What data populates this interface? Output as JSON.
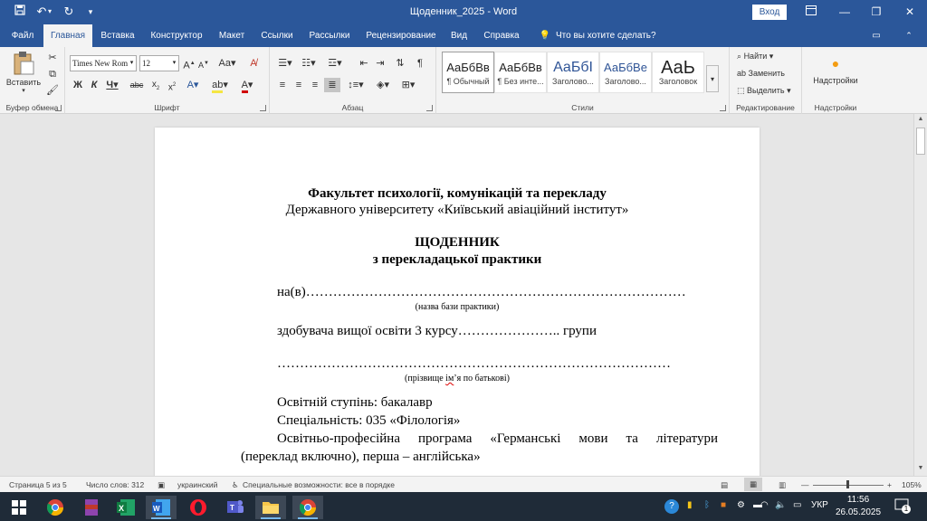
{
  "window": {
    "title": "Щоденник_2025  -  Word",
    "signin": "Вход"
  },
  "tabs": [
    "Файл",
    "Главная",
    "Вставка",
    "Конструктор",
    "Макет",
    "Ссылки",
    "Рассылки",
    "Рецензирование",
    "Вид",
    "Справка"
  ],
  "tell_me": "Что вы хотите сделать?",
  "ribbon": {
    "clipboard": {
      "paste": "Вставить",
      "label": "Буфер обмена"
    },
    "font": {
      "name": "Times New Roman",
      "size": "12",
      "label": "Шрифт"
    },
    "paragraph": {
      "label": "Абзац"
    },
    "styles": {
      "label": "Стили",
      "items": [
        {
          "preview": "АаБбВв",
          "name": "¶ Обычный"
        },
        {
          "preview": "АаБбВв",
          "name": "¶ Без инте..."
        },
        {
          "preview": "АаБбI",
          "name": "Заголово..."
        },
        {
          "preview": "АаБбВе",
          "name": "Заголово..."
        },
        {
          "preview": "АаЬ",
          "name": "Заголовок"
        }
      ]
    },
    "editing": {
      "find": "Найти",
      "replace": "Заменить",
      "select": "Выделить",
      "label": "Редактирование"
    },
    "addins": {
      "button": "Надстройки",
      "label": "Надстройки"
    }
  },
  "document": {
    "line1": "Факультет психології, комунікацій та перекладу",
    "line2": "Державного університету «Київський авіаційний інститут»",
    "title1": "ЩОДЕННИК",
    "title2": "з перекладацької практики",
    "base_line": "на(в)…………………………………………………………………………",
    "base_caption": "(назва бази практики)",
    "student_line": "здобувача вищої освіти 3 курсу………………….. групи",
    "name_line": "……………………………………………………………………………",
    "name_caption_a": "(прізвище ",
    "name_caption_err": "ім",
    "name_caption_b": "’я по батькові)",
    "degree": "Освітній ступінь: бакалавр",
    "specialty": "Спеціальність: 035 «Філологія»",
    "program1_words": [
      "Освітньо-професійна",
      "програма",
      "«Германські",
      "мови",
      "та",
      "літератури"
    ],
    "program2": "(переклад включно), перша – англійська»"
  },
  "status": {
    "page": "Страница 5 из 5",
    "words": "Число слов: 312",
    "language": "украинский",
    "accessibility": "Специальные возможности: все в порядке",
    "zoom": "105%"
  },
  "taskbar": {
    "time": "11:56",
    "date": "26.05.2025",
    "lang": "УКР",
    "notifications": "1"
  },
  "colors": {
    "brand": "#2b579a",
    "accent": "#d83b01"
  }
}
